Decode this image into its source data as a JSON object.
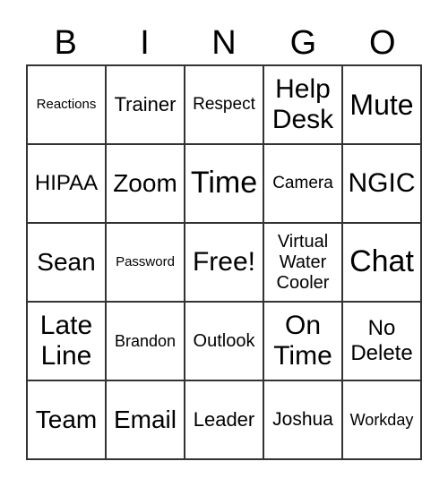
{
  "header": [
    "B",
    "I",
    "N",
    "G",
    "O"
  ],
  "cells": [
    "Reactions",
    "Trainer",
    "Respect",
    "Help Desk",
    "Mute",
    "HIPAA",
    "Zoom",
    "Time",
    "Camera",
    "NGIC",
    "Sean",
    "Password",
    "Free!",
    "Virtual Water Cooler",
    "Chat",
    "Late Line",
    "Brandon",
    "Outlook",
    "On Time",
    "No Delete",
    "Team",
    "Email",
    "Leader",
    "Joshua",
    "Workday"
  ]
}
